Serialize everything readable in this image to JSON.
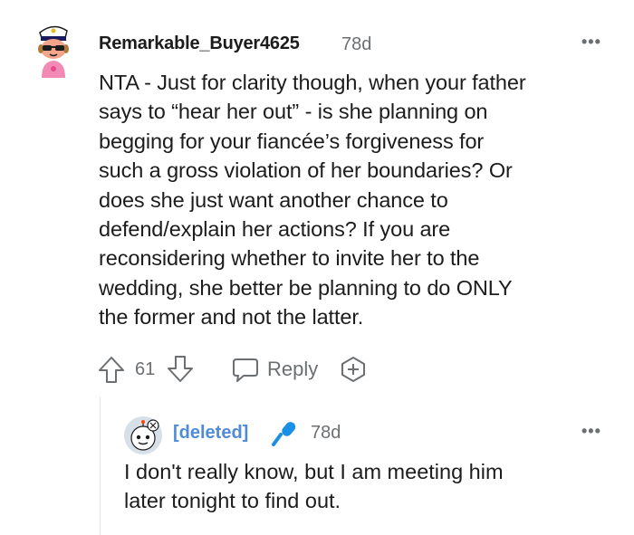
{
  "comment": {
    "username": "Remarkable_Buyer4625",
    "age": "78d",
    "more_label": "•••",
    "body": "NTA - Just for clarity though, when your father\nsays to “hear her out” - is she planning on\nbegging for your fiancée’s forgiveness for\nsuch a gross violation of her boundaries? Or\ndoes she just want another chance to\ndefend/explain her actions? If you are\nreconsidering whether to invite her to the\nwedding, she better be planning to do ONLY\nthe former and not the latter.",
    "vote_count": "61",
    "reply_label": "Reply",
    "icons": {
      "upvote": "upvote-icon",
      "downvote": "downvote-icon",
      "reply": "reply-bubble-icon",
      "award": "award-plus-icon"
    }
  },
  "reply": {
    "username": "[deleted]",
    "age": "78d",
    "more_label": "•••",
    "body": "I don't really know, but I am meeting him\nlater tonight to find out.",
    "badge_icon": "microphone-icon"
  },
  "colors": {
    "text": "#1c1c1c",
    "muted": "#6b6f72",
    "deleted_user": "#4f8bd6",
    "mic_badge": "#1a8fe6",
    "thread_line": "#e6e6e6"
  }
}
